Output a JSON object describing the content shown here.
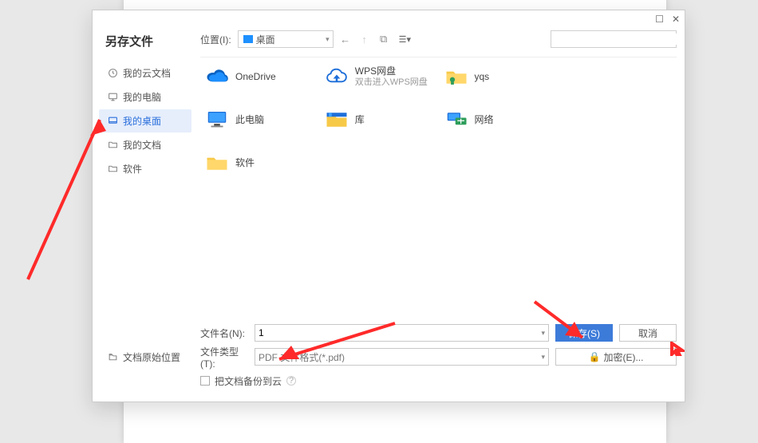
{
  "window": {
    "maximize_glyph": "☐",
    "close_glyph": "✕"
  },
  "dialog_title": "另存文件",
  "location": {
    "label": "位置(I):",
    "value": "桌面"
  },
  "nav": {
    "back_glyph": "←",
    "up_glyph": "↑",
    "newfolder_glyph": "⧉",
    "view_glyph": "☰▾"
  },
  "search": {
    "placeholder": ""
  },
  "sidebar": {
    "items": [
      {
        "label": "我的云文档"
      },
      {
        "label": "我的电脑"
      },
      {
        "label": "我的桌面"
      },
      {
        "label": "我的文档"
      },
      {
        "label": "软件"
      }
    ],
    "bottom": {
      "label": "文档原始位置"
    }
  },
  "files": [
    {
      "name": "OneDrive",
      "sub": "",
      "icon": "onedrive"
    },
    {
      "name": "WPS网盘",
      "sub": "双击进入WPS网盘",
      "icon": "wpscloud"
    },
    {
      "name": "yqs",
      "sub": "",
      "icon": "userfolder"
    },
    {
      "name": "此电脑",
      "sub": "",
      "icon": "pc"
    },
    {
      "name": "库",
      "sub": "",
      "icon": "library"
    },
    {
      "name": "网络",
      "sub": "",
      "icon": "network"
    },
    {
      "name": "软件",
      "sub": "",
      "icon": "folder"
    }
  ],
  "bottom": {
    "filename_label": "文件名(N):",
    "filename_value": "1",
    "filetype_label": "文件类型(T):",
    "filetype_value": "PDF 文件格式(*.pdf)",
    "save_label": "保存(S)",
    "cancel_label": "取消",
    "encrypt_label": "加密(E)...",
    "encrypt_glyph": "🔒",
    "backup_label": "把文档备份到云",
    "backup_help": "?"
  }
}
